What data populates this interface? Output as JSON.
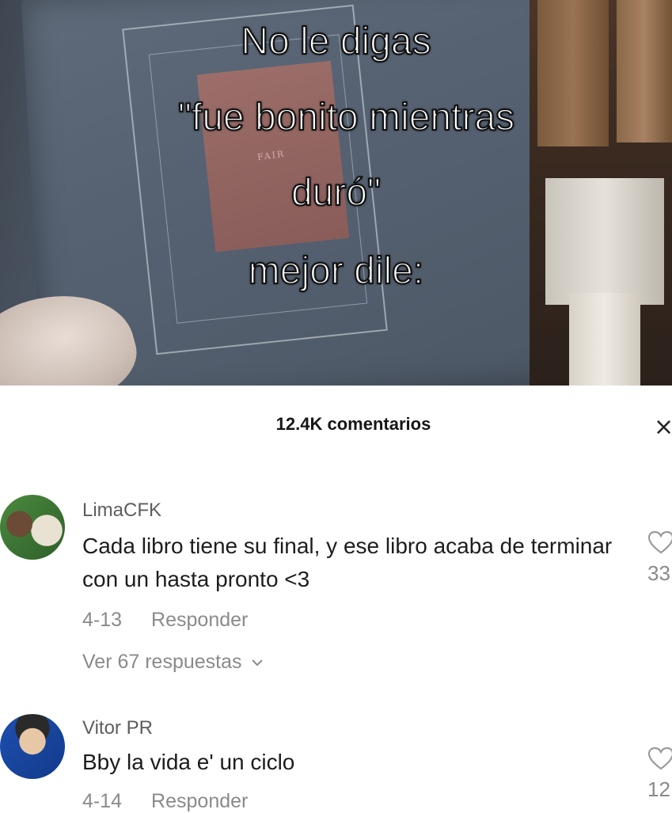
{
  "video": {
    "caption_lines": [
      "No le digas",
      "\"fue bonito mientras",
      "duró\"",
      "mejor dile:"
    ],
    "book_label": "FAIR"
  },
  "comments_panel": {
    "title": "12.4K comentarios",
    "close_glyph": "×",
    "comments": [
      {
        "username": "LimaCFK",
        "text": "Cada libro tiene su final, y ese libro acaba de terminar con un hasta pronto <3",
        "date": "4-13",
        "reply_label": "Responder",
        "view_replies": "Ver 67 respuestas",
        "likes": "33",
        "avatar_icon": "avatar-photo"
      },
      {
        "username": "Vitor PR",
        "text": "Bby la vida e' un ciclo",
        "date": "4-14",
        "reply_label": "Responder",
        "likes": "12",
        "avatar_icon": "avatar-photo"
      }
    ]
  },
  "colors": {
    "text_primary": "#1d1d1d",
    "text_secondary": "#8a8a8a",
    "username": "#5d5d5d",
    "panel_bg": "#ffffff"
  }
}
